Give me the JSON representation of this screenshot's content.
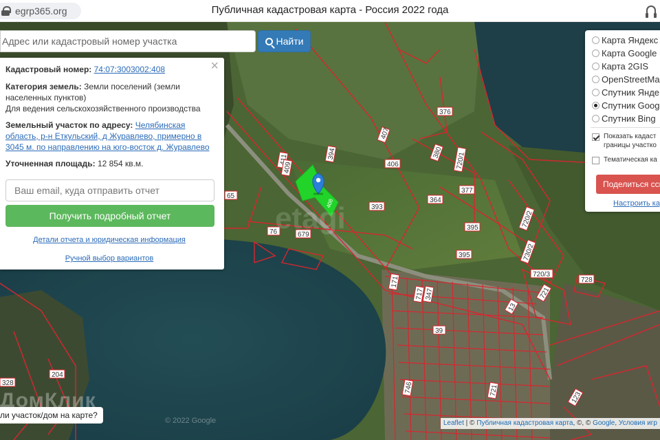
{
  "browser": {
    "url": "egrp365.org",
    "title": "Публичная кадастровая карта - Россия 2022 года"
  },
  "search": {
    "placeholder": "Адрес или кадастровый номер участка",
    "button_label": "Найти"
  },
  "popup": {
    "close_glyph": "×",
    "cadastral_label": "Кадастровый номер:",
    "cadastral_value": "74:07:3003002:408",
    "category_label": "Категория земель:",
    "category_value": "Земли поселений (земли населенных пунктов)",
    "usage": "Для ведения сельскохозяйственного производства",
    "address_label": "Земельный участок по адресу:",
    "address_value": "Челябинская область, р-н Еткульский, д Журавлево, примерно в 3045 м. по направлению на юго-восток д. Журавлево",
    "area_label": "Уточненная площадь:",
    "area_value": "12 854 кв.м.",
    "email_placeholder": "Ваш email, куда отправить отчет",
    "get_report_label": "Получить подробный отчет",
    "details_link": "Детали отчета и юридическая информация",
    "manual_link": "Ручной выбор вариантов"
  },
  "layers": {
    "items": [
      {
        "label": "Карта Яндекс",
        "selected": false
      },
      {
        "label": "Карта Google",
        "selected": false
      },
      {
        "label": "Карта 2GIS",
        "selected": false
      },
      {
        "label": "OpenStreetMa",
        "selected": false
      },
      {
        "label": "Спутник Янде",
        "selected": false
      },
      {
        "label": "Спутник Googl",
        "selected": true
      },
      {
        "label": "Спутник Bing",
        "selected": false
      }
    ],
    "show_cadastral_line1": "Показать кадаст",
    "show_cadastral_line2": "границы участко",
    "thematic": "Тематическая ка",
    "share_label": "Поделиться ссы",
    "settings_link": "Настроить кар"
  },
  "hint": "ли участок/дом на карте?",
  "attribution": {
    "leaflet": "Leaflet",
    "sep1": " | © ",
    "pkk": "Публичная кадастровая карта",
    "sep2": ", ©, © ",
    "google": "Google",
    "sep3": ", ",
    "terms": "Условия игр"
  },
  "watermarks": {
    "google": "© 2022 Google",
    "domclick": "ДомКлик",
    "etagi": "etagi"
  },
  "parcel_labels": [
    "407",
    "376",
    "411",
    "394",
    "406",
    "409",
    "380",
    "720/1",
    "364",
    "393",
    "377",
    "395",
    "720/2",
    "65",
    "76",
    "679",
    "395",
    "720/3",
    "728",
    "730/2",
    "171",
    "717",
    "347",
    "13",
    "721",
    "39",
    "204",
    "328",
    "746",
    "721",
    "123",
    "408"
  ],
  "colors": {
    "parcel_line": "#d8262e",
    "selected_parcel": "#22d42a",
    "marker": "#2b7fd8",
    "search_button": "#337ab7",
    "report_button": "#5cb85c",
    "share_button": "#d9534f"
  }
}
